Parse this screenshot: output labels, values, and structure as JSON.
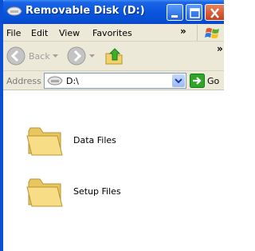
{
  "window": {
    "title": "Removable Disk (D:)",
    "title_bar_color": "#0a58e0",
    "close_button_color": "#c8401e"
  },
  "menubar": {
    "items": [
      "File",
      "Edit",
      "View",
      "Favorites"
    ],
    "overflow": "»"
  },
  "toolbar": {
    "back_label": "Back",
    "overflow": "»"
  },
  "address": {
    "label": "Address",
    "value": "D:\\",
    "go_label": "Go"
  },
  "files": [
    {
      "name": "Data Files",
      "icon": "folder-icon"
    },
    {
      "name": "Setup Files",
      "icon": "folder-icon"
    }
  ]
}
